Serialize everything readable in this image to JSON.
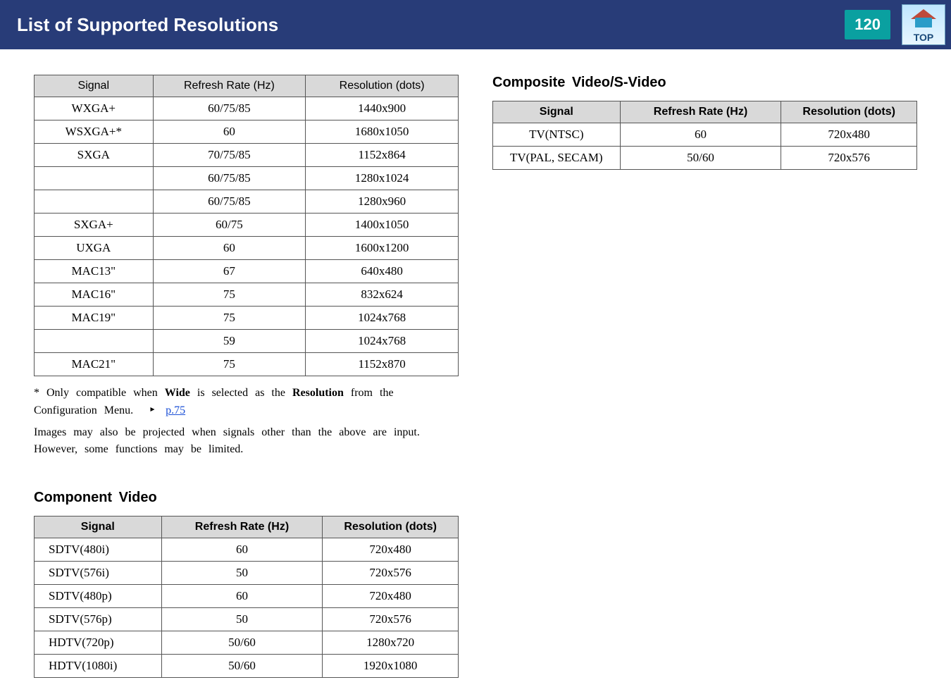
{
  "header": {
    "title": "List of Supported Resolutions",
    "page_number": "120",
    "logo_label": "TOP"
  },
  "table1": {
    "headers": [
      "Signal",
      "Refresh Rate (Hz)",
      "Resolution (dots)"
    ],
    "rows": [
      [
        "WXGA+",
        "60/75/85",
        "1440x900"
      ],
      [
        "WSXGA+*",
        "60",
        "1680x1050"
      ],
      [
        "SXGA",
        "70/75/85",
        "1152x864"
      ],
      [
        "",
        "60/75/85",
        "1280x1024"
      ],
      [
        "",
        "60/75/85",
        "1280x960"
      ],
      [
        "SXGA+",
        "60/75",
        "1400x1050"
      ],
      [
        "UXGA",
        "60",
        "1600x1200"
      ],
      [
        "MAC13\"",
        "67",
        "640x480"
      ],
      [
        "MAC16\"",
        "75",
        "832x624"
      ],
      [
        "MAC19\"",
        "75",
        "1024x768"
      ],
      [
        "",
        "59",
        "1024x768"
      ],
      [
        "MAC21\"",
        "75",
        "1152x870"
      ]
    ]
  },
  "footnote": {
    "line1_pre": "* Only compatible when ",
    "line1_b1": "Wide",
    "line1_mid": " is selected as the ",
    "line1_b2": "Resolution",
    "line1_post": " from the",
    "line2_pre": "Configuration Menu. ",
    "link": "p.75",
    "line3": "Images may also be projected when signals other than the above are input. However, some functions may be limited."
  },
  "section_component": {
    "heading": "Component Video",
    "headers": [
      "Signal",
      "Refresh Rate (Hz)",
      "Resolution (dots)"
    ],
    "rows": [
      [
        "SDTV(480i)",
        "60",
        "720x480"
      ],
      [
        "SDTV(576i)",
        "50",
        "720x576"
      ],
      [
        "SDTV(480p)",
        "60",
        "720x480"
      ],
      [
        "SDTV(576p)",
        "50",
        "720x576"
      ],
      [
        "HDTV(720p)",
        "50/60",
        "1280x720"
      ],
      [
        "HDTV(1080i)",
        "50/60",
        "1920x1080"
      ]
    ]
  },
  "section_composite": {
    "heading": "Composite Video/S-Video",
    "headers": [
      "Signal",
      "Refresh Rate (Hz)",
      "Resolution (dots)"
    ],
    "rows": [
      [
        "TV(NTSC)",
        "60",
        "720x480"
      ],
      [
        "TV(PAL, SECAM)",
        "50/60",
        "720x576"
      ]
    ]
  }
}
